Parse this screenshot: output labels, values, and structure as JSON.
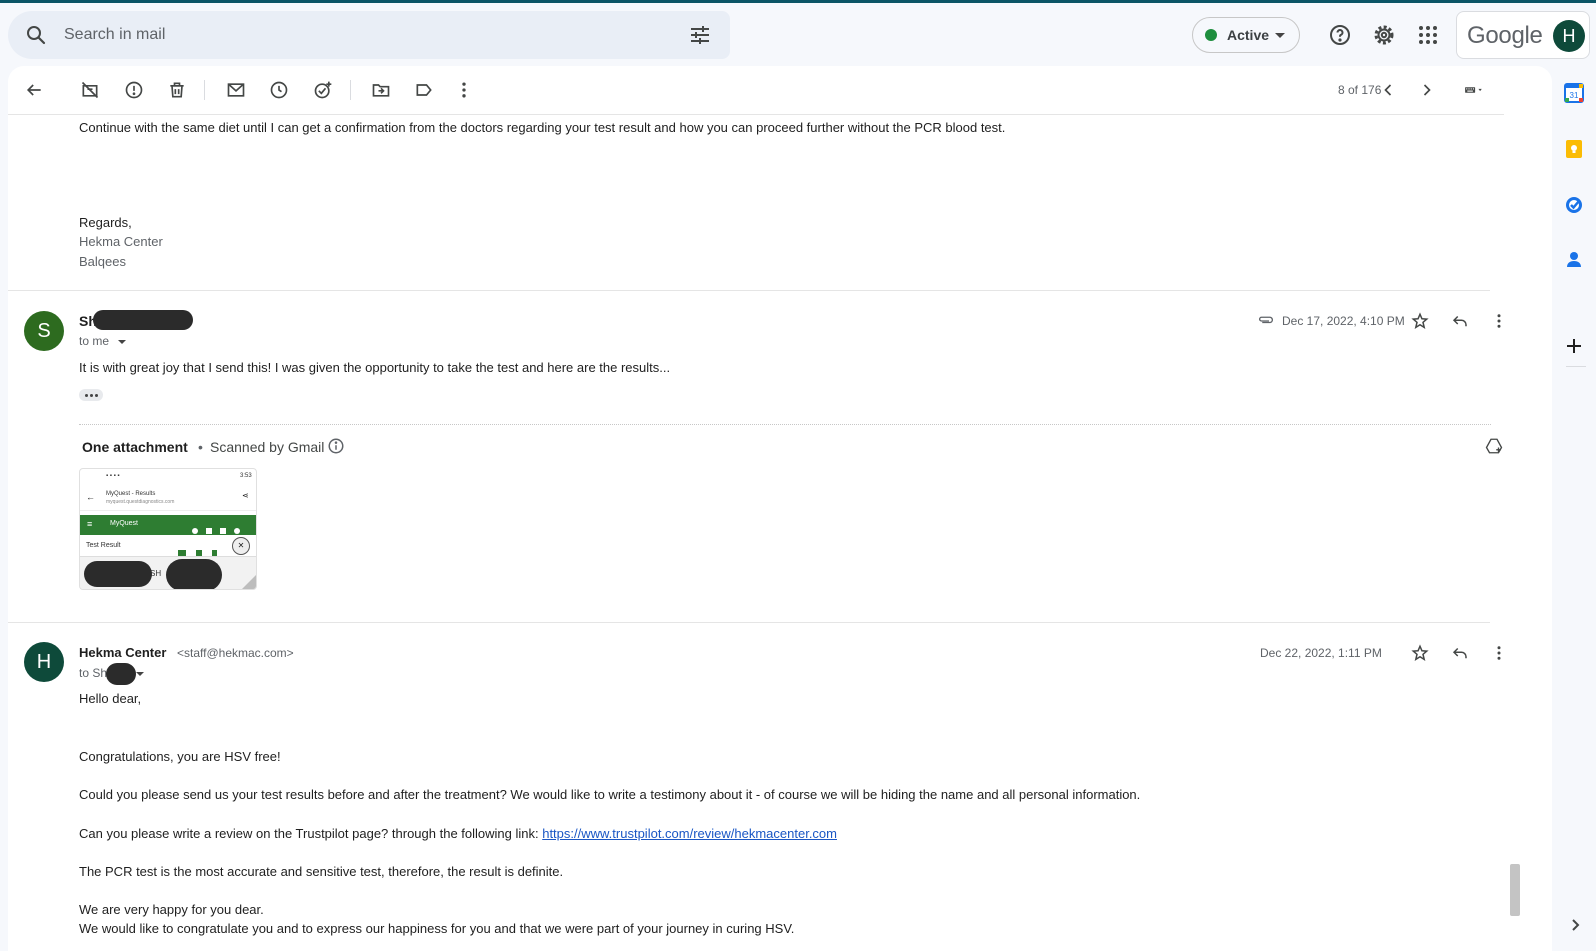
{
  "header": {
    "search_placeholder": "Search in mail",
    "status_label": "Active",
    "google_word": "Google",
    "account_initial": "H"
  },
  "toolbar": {
    "pager": "8 of 176"
  },
  "messages": [
    {
      "body_lines": [
        "Continue with the same diet until I can get a confirmation from the doctors regarding your test result and how you can proceed further without the PCR blood test.",
        "Regards,",
        "Hekma Center",
        "Balqees"
      ]
    },
    {
      "avatar_initial": "S",
      "avatar_color": "#2d6b1f",
      "sender_visible": "Sh",
      "to_label": "to me",
      "date": "Dec 17, 2022, 4:10 PM",
      "snippet": "It is with great joy that I send this! I was given the opportunity to take the test and here are the results...",
      "attachment_heading": "One attachment",
      "attachment_scan": "Scanned by Gmail",
      "thumb": {
        "site_title": "MyQuest - Results",
        "site_url": "myquest.questdiagnostics.com",
        "brand": "MyQuest",
        "row_label": "Test Result",
        "partial_name": "SH",
        "time": "3:53"
      }
    },
    {
      "avatar_initial": "H",
      "avatar_color": "#0e4a3a",
      "sender": "Hekma Center",
      "sender_email": "<staff@hekmac.com>",
      "to_label": "to Sh",
      "date": "Dec 22, 2022, 1:11 PM",
      "greeting": "Hello dear,",
      "p1": "Congratulations, you are HSV free!",
      "p2": "Could you please send us your test results before and after the treatment? We would like to write a testimony about it - of course we will be hiding the name and all personal information.",
      "p3_text": "Can you please write a review on the Trustpilot page? through the following link: ",
      "p3_link": "https://www.trustpilot.com/review/hekmacenter.com",
      "p4": "The PCR test is the most accurate and sensitive test, therefore, the result is definite.",
      "p5": "We are very happy for you dear.",
      "p6": "We would like to congratulate you and to express our happiness for you and that we were part of your journey in curing HSV."
    }
  ],
  "side_panel": {
    "calendar_day": "31"
  }
}
